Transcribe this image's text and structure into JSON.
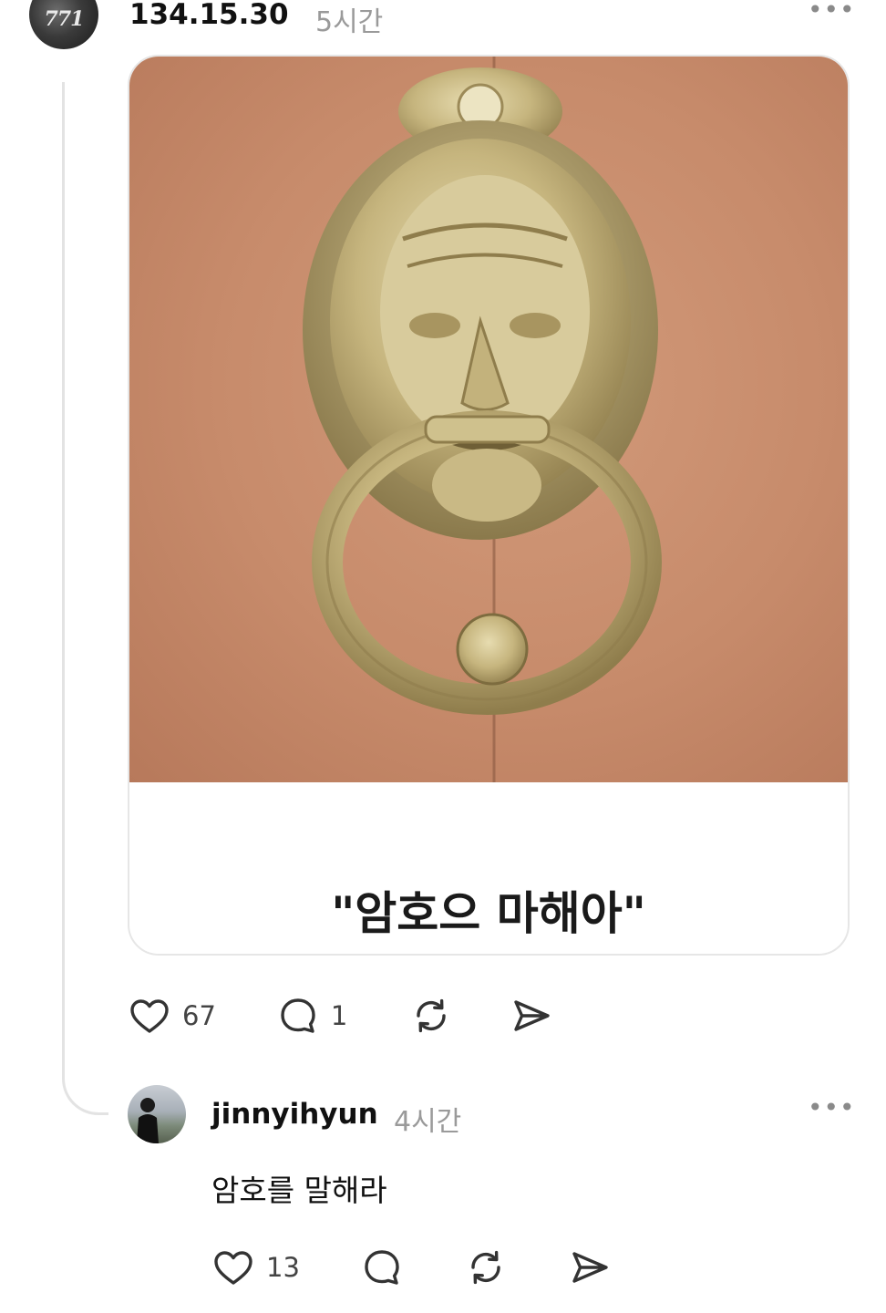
{
  "post": {
    "avatar_text": "771",
    "username": "134.15.30",
    "time": "5시간",
    "more": "•••",
    "caption": "\"암호으 마해아\"",
    "like_count": "67",
    "comment_count": "1"
  },
  "reply": {
    "username": "jinnyihyun",
    "time": "4시간",
    "more": "•••",
    "text": "암호를 말해라",
    "like_count": "13"
  },
  "colors": {
    "background": "#ffffff",
    "secondary_text": "#9a9a9a",
    "icon": "#333333",
    "thread_line": "#e3e3e3"
  }
}
